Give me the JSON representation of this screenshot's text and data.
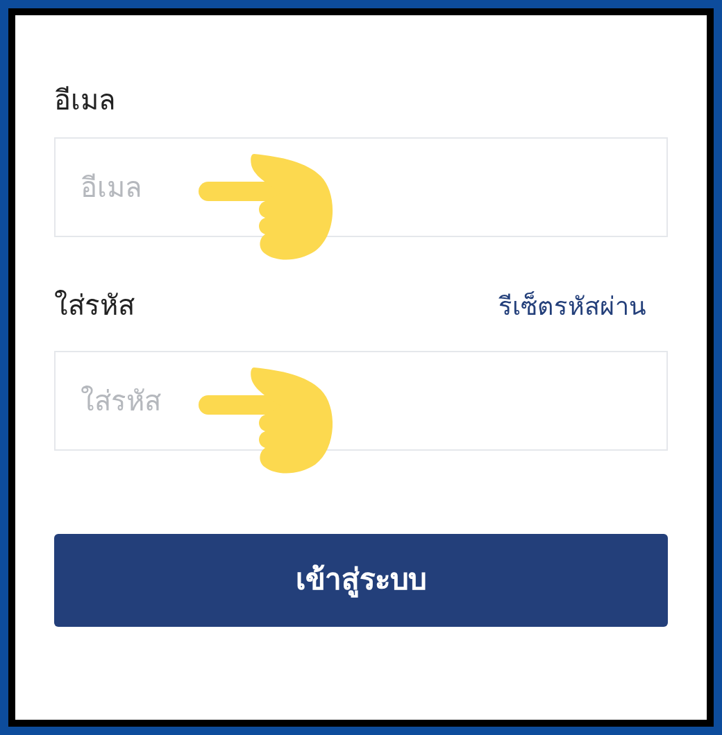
{
  "email": {
    "label": "อีเมล",
    "placeholder": "อีเมล"
  },
  "password": {
    "label": "ใส่รหัส",
    "placeholder": "ใส่รหัส",
    "reset_link": "รีเซ็ตรหัสผ่าน"
  },
  "submit_button": "เข้าสู่ระบบ"
}
